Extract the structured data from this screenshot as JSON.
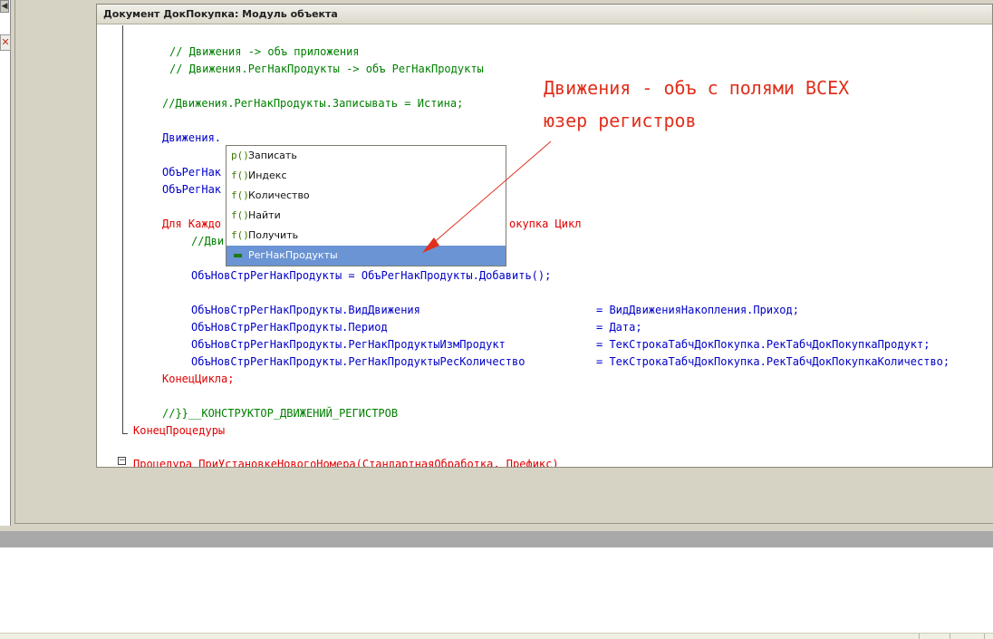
{
  "window": {
    "title": "Документ ДокПокупка: Модуль объекта"
  },
  "left_window": {
    "close_glyph": "✕",
    "scroll_glyph": "◀"
  },
  "code_lines": [
    {
      "text": "// Движения -> объ приложения",
      "kind": "comment"
    },
    {
      "text": "// Движения.РегНакПродукты -> объ РегНакПродукты",
      "kind": "comment"
    },
    {
      "text": "//Движения.РегНакПродукты.Записывать = Истина;",
      "kind": "comment"
    },
    {
      "text": "Движения.",
      "kind": "ident"
    },
    {
      "text": "ОбъРегНак",
      "kind": "ident"
    },
    {
      "text": "ОбъРегНак",
      "kind": "ident"
    },
    {
      "text": "Для Каждо",
      "kind": "kw"
    },
    {
      "text": "окупка Цикл",
      "kind": "kw"
    },
    {
      "text": "//Дви",
      "kind": "comment"
    },
    {
      "text": "ОбъНовСтрРегНакПродукты = ОбъРегНакПродукты.Добавить();",
      "kind": "ident"
    },
    {
      "text": "ОбъНовСтрРегНакПродукты.ВидДвижения",
      "kind": "ident"
    },
    {
      "text": "= ВидДвиженияНакопления.Приход;",
      "kind": "ident"
    },
    {
      "text": "ОбъНовСтрРегНакПродукты.Период",
      "kind": "ident"
    },
    {
      "text": "= Дата;",
      "kind": "ident"
    },
    {
      "text": "ОбъНовСтрРегНакПродукты.РегНакПродуктыИзмПродукт",
      "kind": "ident"
    },
    {
      "text": "= ТекСтрокаТабчДокПокупка.РекТабчДокПокупкаПродукт;",
      "kind": "ident"
    },
    {
      "text": "ОбъНовСтрРегНакПродукты.РегНакПродуктыРесКоличество",
      "kind": "ident"
    },
    {
      "text": "= ТекСтрокаТабчДокПокупка.РекТабчДокПокупкаКоличество;",
      "kind": "ident"
    },
    {
      "text": "КонецЦикла;",
      "kind": "kw"
    },
    {
      "text": "//}}__КОНСТРУКТОР_ДВИЖЕНИЙ_РЕГИСТРОВ",
      "kind": "comment"
    },
    {
      "text": "КонецПроцедуры",
      "kind": "kw"
    },
    {
      "text": "Процедура ПриУстановкеНовогоНомера(СтандартнаяОбработка, Префикс)",
      "kind": "kw"
    }
  ],
  "annotation": {
    "line1": "Движения - объ с полями ВСЕХ",
    "line2": "юзер регистров"
  },
  "autocomplete": {
    "items": [
      {
        "icon": "p()",
        "label": "Записать",
        "selected": false
      },
      {
        "icon": "f()",
        "label": "Индекс",
        "selected": false
      },
      {
        "icon": "f()",
        "label": "Количество",
        "selected": false
      },
      {
        "icon": "f()",
        "label": "Найти",
        "selected": false
      },
      {
        "icon": "f()",
        "label": "Получить",
        "selected": false
      },
      {
        "icon": "",
        "label": "РегНакПродукты",
        "selected": true
      }
    ]
  },
  "colors": {
    "comment": "#008000",
    "identifier": "#0000c8",
    "keyword": "#e00000",
    "annotation": "#e0301c",
    "selection": "#6a94d4"
  }
}
